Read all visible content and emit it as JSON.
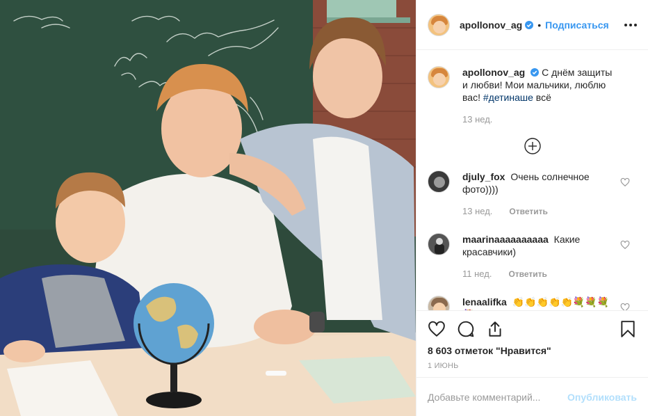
{
  "post": {
    "author": "apollonov_ag",
    "dot": "•",
    "follow_label": "Подписаться",
    "caption_text": "С днём защиты и любви! Мои мальчики, люблю вас!",
    "caption_hashtag": "#детинаше",
    "caption_tail": "всё",
    "caption_time": "13 нед.",
    "likes": "8 603 отметок \"Нравится\"",
    "date": "1 июнь"
  },
  "photo": {
    "chalk_lines": [
      "Удачи тебе вовсем! С днём Рождения",
      "успехов",
      "Андрюха!!!"
    ]
  },
  "comments": [
    {
      "user": "djuly_fox",
      "text": "Очень солнечное фото))))",
      "time": "13 нед.",
      "reply": "Ответить"
    },
    {
      "user": "maarinaaaaaaaaaa",
      "text": "Какие красавчики)",
      "time": "11 нед.",
      "reply": "Ответить"
    },
    {
      "user": "lenaalifka",
      "text": "👏👏👏👏👏💐💐💐💐",
      "time": "",
      "reply": ""
    }
  ],
  "add_comment": {
    "placeholder": "Добавьте комментарий...",
    "publish": "Опубликовать"
  },
  "colors": {
    "link": "#3897f0",
    "muted": "#999999",
    "border": "#efefef",
    "chalkboard": "#2f4a3c"
  }
}
